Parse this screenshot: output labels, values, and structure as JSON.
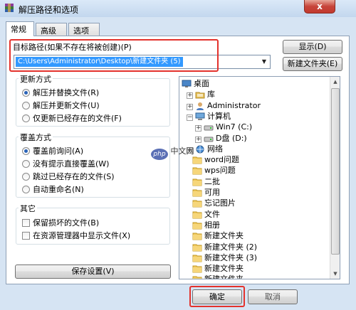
{
  "window": {
    "title": "解压路径和选项",
    "close_glyph": "x"
  },
  "tabs": [
    {
      "label": "常规"
    },
    {
      "label": "高级"
    },
    {
      "label": "选项"
    }
  ],
  "path": {
    "label": "目标路径(如果不存在将被创建)(P)",
    "value": "C:\\Users\\Administrator\\Desktop\\新建文件夹 (5)"
  },
  "buttons": {
    "show": "显示(D)",
    "new_folder": "新建文件夹(E)",
    "save_settings": "保存设置(V)",
    "ok": "确定",
    "cancel": "取消"
  },
  "update_group": {
    "title": "更新方式",
    "options": [
      {
        "label": "解压并替换文件(R)",
        "selected": true
      },
      {
        "label": "解压并更新文件(U)",
        "selected": false
      },
      {
        "label": "仅更新已经存在的文件(F)",
        "selected": false
      }
    ]
  },
  "overwrite_group": {
    "title": "覆盖方式",
    "options": [
      {
        "label": "覆盖前询问(A)",
        "selected": true
      },
      {
        "label": "没有提示直接覆盖(W)",
        "selected": false
      },
      {
        "label": "跳过已经存在的文件(S)",
        "selected": false
      },
      {
        "label": "自动重命名(N)",
        "selected": false
      }
    ]
  },
  "misc_group": {
    "title": "其它",
    "options": [
      {
        "label": "保留损坏的文件(B)",
        "checked": false
      },
      {
        "label": "在资源管理器中显示文件(X)",
        "checked": false
      }
    ]
  },
  "tree": [
    {
      "label": "桌面",
      "icon": "desktop-icon",
      "expander": ""
    },
    {
      "label": "库",
      "icon": "library-icon",
      "expander": "+"
    },
    {
      "label": "Administrator",
      "icon": "user-icon",
      "expander": "+"
    },
    {
      "label": "计算机",
      "icon": "computer-icon",
      "expander": "−"
    },
    {
      "label": "Win7 (C:)",
      "icon": "drive-icon",
      "expander": "+"
    },
    {
      "label": "D盘 (D:)",
      "icon": "drive-icon",
      "expander": "+"
    },
    {
      "label": "网络",
      "icon": "network-icon",
      "expander": "+"
    },
    {
      "label": "word问题",
      "icon": "folder-icon",
      "expander": ""
    },
    {
      "label": "wps问题",
      "icon": "folder-icon",
      "expander": ""
    },
    {
      "label": "二批",
      "icon": "folder-icon",
      "expander": ""
    },
    {
      "label": "可用",
      "icon": "folder-icon",
      "expander": ""
    },
    {
      "label": "忘记图片",
      "icon": "folder-icon",
      "expander": ""
    },
    {
      "label": "文件",
      "icon": "folder-icon",
      "expander": ""
    },
    {
      "label": "相册",
      "icon": "folder-icon",
      "expander": ""
    },
    {
      "label": "新建文件夹",
      "icon": "folder-icon",
      "expander": ""
    },
    {
      "label": "新建文件夹 (2)",
      "icon": "folder-icon",
      "expander": ""
    },
    {
      "label": "新建文件夹 (3)",
      "icon": "folder-icon",
      "expander": ""
    },
    {
      "label": "新建文件夹",
      "icon": "folder-icon",
      "expander": ""
    },
    {
      "label": "新建文件夹",
      "icon": "folder-icon",
      "expander": ""
    }
  ],
  "watermark": {
    "logo": "php",
    "text": "中文网"
  },
  "colors": {
    "highlight": "#3399ff",
    "annotation_red": "#e3322c",
    "window_frame": "#d6e4f3"
  }
}
